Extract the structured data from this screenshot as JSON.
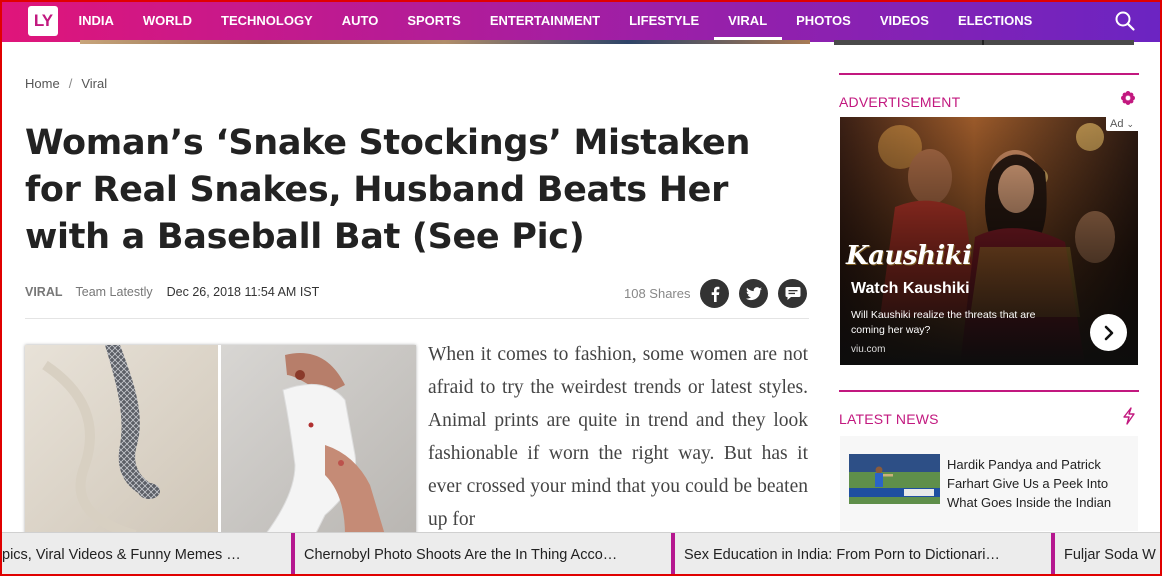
{
  "nav": {
    "logo": "LY",
    "items": [
      "INDIA",
      "WORLD",
      "TECHNOLOGY",
      "AUTO",
      "SPORTS",
      "ENTERTAINMENT",
      "LIFESTYLE",
      "VIRAL",
      "PHOTOS",
      "VIDEOS",
      "ELECTIONS"
    ],
    "active": "VIRAL",
    "search_icon": "search-icon"
  },
  "breadcrumb": {
    "home": "Home",
    "separator": "/",
    "current": "Viral"
  },
  "article": {
    "title": "Woman’s ‘Snake Stockings’ Mistaken for Real Snakes, Husband Beats Her with a Baseball Bat (See Pic)",
    "category": "VIRAL",
    "author": "Team Latestly",
    "date": "Dec 26, 2018 11:54 AM IST",
    "shares": "108 Shares",
    "share_icons": [
      "facebook-icon",
      "twitter-icon",
      "comment-icon"
    ],
    "body": "When it comes to fashion, some women are not afraid to try the weirdest trends or latest styles. Animal prints are quite in trend and they look fashionable if worn the right way. But has it ever crossed your mind that you could be beaten up for"
  },
  "sidebar": {
    "advertisement_label": "ADVERTISEMENT",
    "ad": {
      "badge": "Ad",
      "brand": "Kaushiki",
      "headline": "Watch Kaushiki",
      "text": "Will Kaushiki realize the threats that are coming her way?",
      "url": "viu.com"
    },
    "latest_news_label": "LATEST NEWS",
    "latest_news": [
      {
        "title": "Hardik Pandya and Patrick Farhart Give Us a Peek Into What Goes Inside the Indian"
      }
    ]
  },
  "ticker": [
    "pics, Viral Videos & Funny Memes …",
    "Chernobyl Photo Shoots Are the In Thing Acco…",
    "Sex Education in India: From Porn to Dictionari…",
    "Fuljar Soda W"
  ],
  "colors": {
    "brand": "#c2187f",
    "nav_start": "#e0157a",
    "nav_end": "#6b24c2"
  }
}
